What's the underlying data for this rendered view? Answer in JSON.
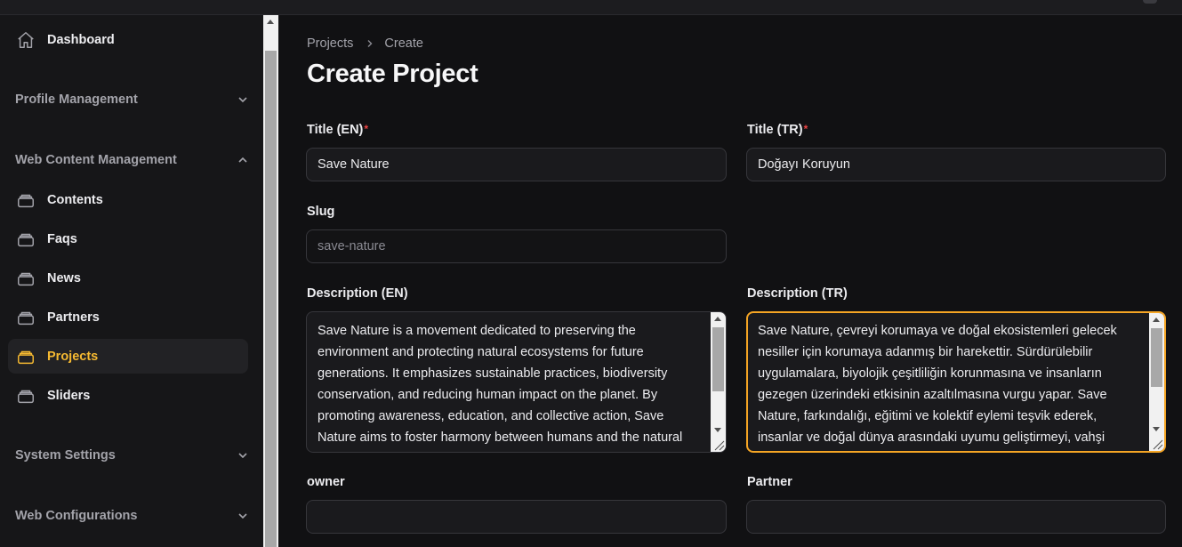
{
  "sidebar": {
    "dashboard": "Dashboard",
    "profile_management": "Profile Management",
    "web_content_management": "Web Content Management",
    "items": [
      {
        "label": "Contents",
        "icon": "stack-icon"
      },
      {
        "label": "Faqs",
        "icon": "stack-icon"
      },
      {
        "label": "News",
        "icon": "stack-icon"
      },
      {
        "label": "Partners",
        "icon": "stack-icon"
      },
      {
        "label": "Projects",
        "icon": "stack-icon",
        "active": true
      },
      {
        "label": "Sliders",
        "icon": "stack-icon"
      }
    ],
    "system_settings": "System Settings",
    "web_configurations": "Web Configurations"
  },
  "breadcrumb": {
    "parent": "Projects",
    "current": "Create"
  },
  "page": {
    "title": "Create Project"
  },
  "form": {
    "title_en": {
      "label": "Title (EN)",
      "required": "*",
      "value": "Save Nature"
    },
    "title_tr": {
      "label": "Title (TR)",
      "required": "*",
      "value": "Doğayı Koruyun"
    },
    "slug": {
      "label": "Slug",
      "value": "save-nature"
    },
    "description_en": {
      "label": "Description (EN)",
      "value": "Save Nature is a movement dedicated to preserving the environment and protecting natural ecosystems for future generations. It emphasizes sustainable practices, biodiversity conservation, and reducing human impact on the planet. By promoting awareness, education, and collective action, Save Nature aims to foster harmony between humans and the natural"
    },
    "description_tr": {
      "label": "Description (TR)",
      "value": "Save Nature, çevreyi korumaya ve doğal ekosistemleri gelecek nesiller için korumaya adanmış bir harekettir. Sürdürülebilir uygulamalara, biyolojik çeşitliliğin korunmasına ve insanların gezegen üzerindeki etkisinin azaltılmasına vurgu yapar. Save Nature, farkındalığı, eğitimi ve kolektif eylemi teşvik ederek, insanlar ve doğal dünya arasındaki uyumu geliştirmeyi, vahşi"
    },
    "owner": {
      "label": "owner",
      "value": ""
    },
    "partner": {
      "label": "Partner",
      "value": ""
    }
  },
  "colors": {
    "accent": "#f5b931",
    "focus_ring": "#f5a524",
    "required": "#ef4444",
    "background": "#111113",
    "sidebar": "#161618"
  }
}
